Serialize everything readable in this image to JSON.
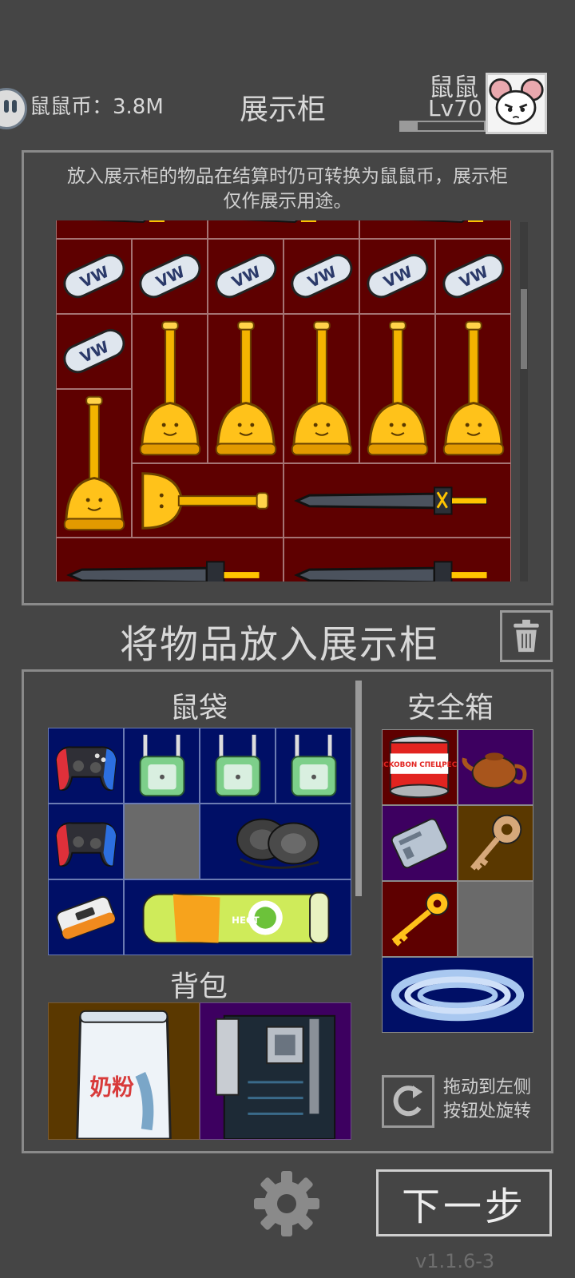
{
  "header": {
    "currency_label": "鼠鼠币：3.8M",
    "title": "展示柜",
    "player_name": "鼠鼠",
    "player_level": "Lv70",
    "level_progress": 0.2
  },
  "showcase": {
    "notice": "放入展示柜的物品在结算时仍可转换为鼠鼠币，展示柜仅作展示用途。",
    "background_color": "#5e0000"
  },
  "placement": {
    "heading": "将物品放入展示柜"
  },
  "inventory": {
    "pouch_title": "鼠袋",
    "backpack_title": "背包",
    "safe_title": "安全箱",
    "pouch_color": "#000f66",
    "can_text": "BOHCKOBON СПЕЦРЕСЕРВ",
    "powder_label": "奶粉",
    "drink_label": "НЕСТ",
    "rotate_hint": "拖动到左侧按钮处旋转"
  },
  "footer": {
    "next_label": "下一步",
    "version": "v1.1.6-3"
  }
}
